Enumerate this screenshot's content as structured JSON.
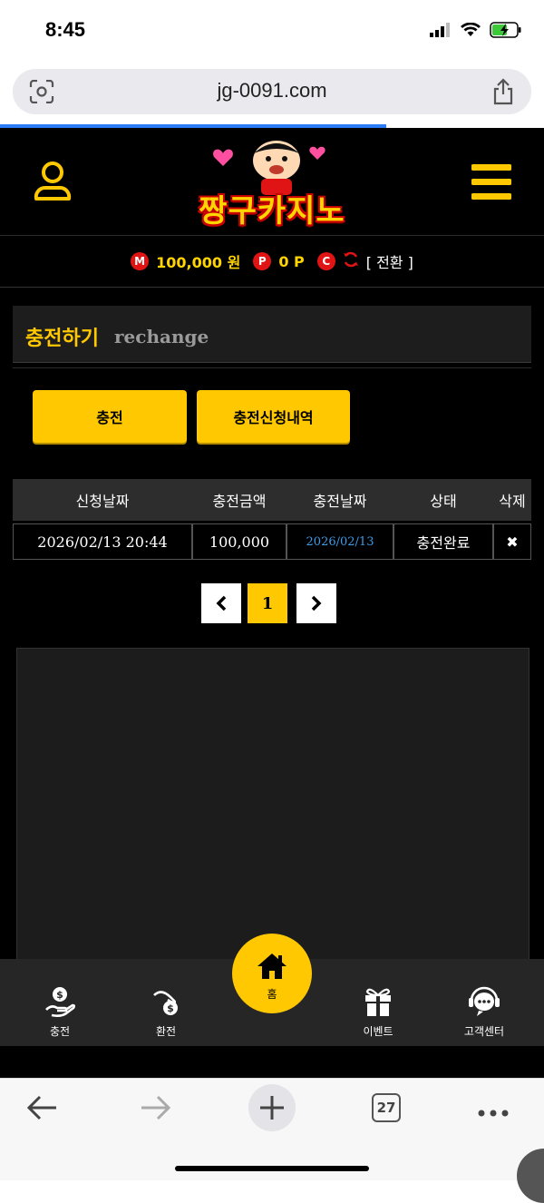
{
  "status": {
    "time": "8:45"
  },
  "browser": {
    "url": "jg-0091.com",
    "tabs_count": "27",
    "load_progress": 0.71
  },
  "header": {
    "logo_text": "짱구카지노"
  },
  "balance": {
    "money_icon": "M",
    "money": "100,000 원",
    "point_icon": "P",
    "point": "0 P",
    "casino_icon": "C",
    "switch_label": "[ 전환 ]"
  },
  "section": {
    "title_ko": "충전하기",
    "title_en": "rechange"
  },
  "buttons": {
    "charge": "충전",
    "history": "충전신청내역"
  },
  "table": {
    "headers": [
      "신청날짜",
      "충전금액",
      "충전날짜",
      "상태",
      "삭제"
    ],
    "rows": [
      {
        "request_date": "2026/02/13 20:44",
        "amount": "100,000",
        "charge_date": "2026/02/13",
        "status": "충전완료",
        "delete": "✖"
      }
    ]
  },
  "pagination": {
    "prev": "‹",
    "current": "1",
    "next": "›"
  },
  "bottom_nav": [
    {
      "label": "충전",
      "icon": "deposit-icon"
    },
    {
      "label": "환전",
      "icon": "withdraw-icon"
    },
    {
      "label": "홈",
      "icon": "home-icon"
    },
    {
      "label": "이벤트",
      "icon": "gift-icon"
    },
    {
      "label": "고객센터",
      "icon": "support-icon"
    }
  ],
  "colors": {
    "accent": "#ffc800",
    "background": "#000000",
    "badge": "#e01414",
    "link": "#3d9be8"
  }
}
